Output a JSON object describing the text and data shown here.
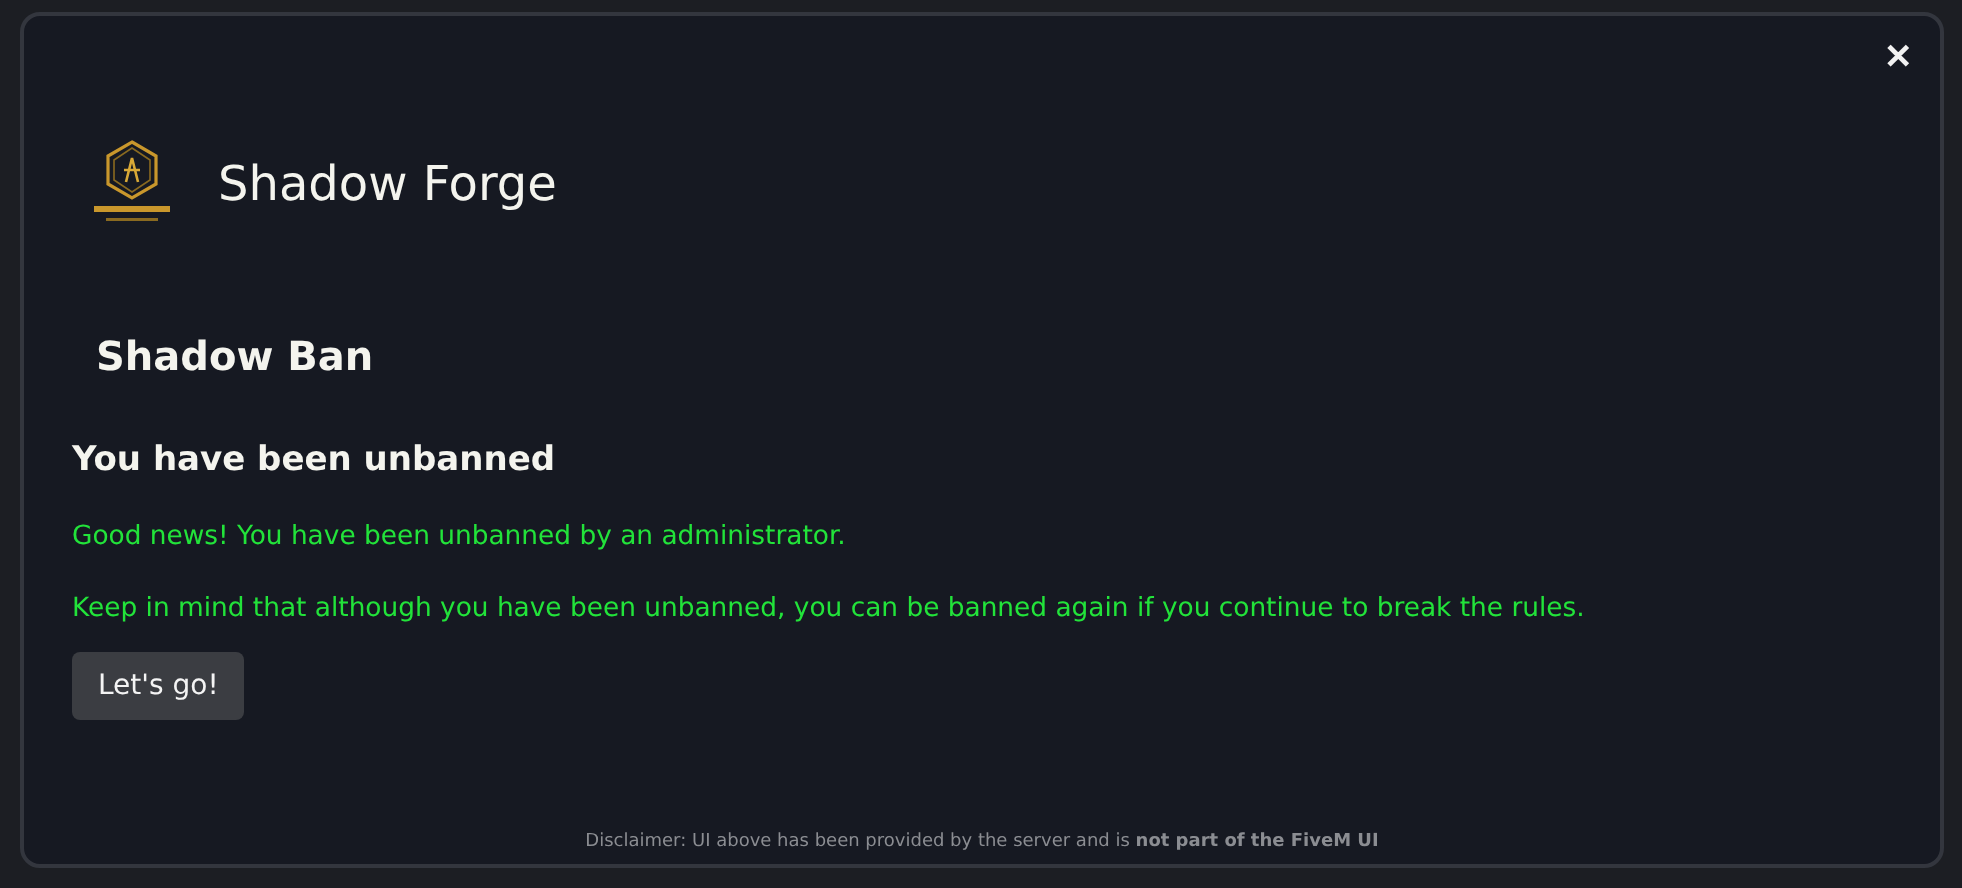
{
  "close_button": {
    "label": "✕"
  },
  "brand": {
    "name": "Shadow Forge"
  },
  "heading": "Shadow Ban",
  "message": {
    "title": "You have been unbanned",
    "paragraphs": [
      "Good news! You have been unbanned by an administrator.",
      "Keep in mind that although you have been unbanned, you can be banned again if you continue to break the rules."
    ]
  },
  "button": {
    "label": "Let's go!"
  },
  "disclaimer": "Disclaimer: UI above has been provided by the server and is **not part of the FiveM UI**"
}
